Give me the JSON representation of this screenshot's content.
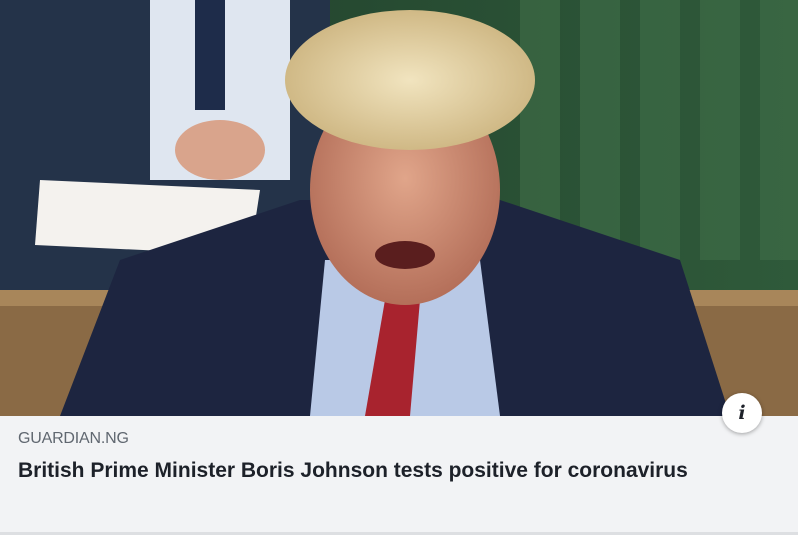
{
  "link_preview": {
    "domain": "GUARDIAN.NG",
    "title": "British Prime Minister Boris Johnson tests positive for coronavirus",
    "info_icon": "i"
  }
}
